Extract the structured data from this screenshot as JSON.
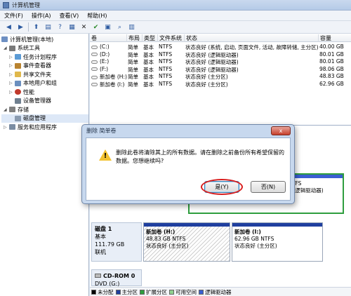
{
  "window": {
    "title": "计算机管理"
  },
  "menu": [
    "文件(F)",
    "操作(A)",
    "查看(V)",
    "帮助(H)"
  ],
  "toolbar_icons": [
    "back-icon",
    "forward-icon",
    "up-icon",
    "show-hide-tree-icon",
    "help-icon",
    "properties-icon",
    "delete-icon",
    "check-icon",
    "open-icon",
    "search-icon",
    "export-icon"
  ],
  "tree": [
    {
      "label": "计算机管理(本地)",
      "level": 0,
      "icon": "computer-icon",
      "color": "#6d8fc2"
    },
    {
      "label": "系统工具",
      "level": 1,
      "icon": "tools-icon",
      "color": "#7a7a7a"
    },
    {
      "label": "任务计划程序",
      "level": 2,
      "icon": "clock-icon",
      "color": "#5b9bd5"
    },
    {
      "label": "事件查看器",
      "level": 2,
      "icon": "event-icon",
      "color": "#b9832f"
    },
    {
      "label": "共享文件夹",
      "level": 2,
      "icon": "folder-icon",
      "color": "#e0b84b"
    },
    {
      "label": "本地用户和组",
      "level": 2,
      "icon": "users-icon",
      "color": "#6b8fbf"
    },
    {
      "label": "性能",
      "level": 2,
      "icon": "performance-icon",
      "color": "#c0392b"
    },
    {
      "label": "设备管理器",
      "level": 2,
      "icon": "device-icon",
      "color": "#6f7f8f"
    },
    {
      "label": "存储",
      "level": 1,
      "icon": "storage-icon",
      "color": "#808080"
    },
    {
      "label": "磁盘管理",
      "level": 2,
      "icon": "disk-icon",
      "color": "#8a9bb0",
      "selected": true
    },
    {
      "label": "服务和应用程序",
      "level": 1,
      "icon": "services-icon",
      "color": "#7b8da3"
    }
  ],
  "columns": [
    "卷",
    "布局",
    "类型",
    "文件系统",
    "状态",
    "容量"
  ],
  "volumes": [
    {
      "name": "(C:)",
      "layout": "简单",
      "type": "基本",
      "fs": "NTFS",
      "status": "状态良好 (系统, 启动, 页面文件, 活动, 故障转储, 主分区)",
      "capacity": "40.00 GB"
    },
    {
      "name": "(D:)",
      "layout": "简单",
      "type": "基本",
      "fs": "NTFS",
      "status": "状态良好 (逻辑驱动器)",
      "capacity": "80.01 GB"
    },
    {
      "name": "(E:)",
      "layout": "简单",
      "type": "基本",
      "fs": "NTFS",
      "status": "状态良好 (逻辑驱动器)",
      "capacity": "80.01 GB"
    },
    {
      "name": "(F:)",
      "layout": "简单",
      "type": "基本",
      "fs": "NTFS",
      "status": "状态良好 (逻辑驱动器)",
      "capacity": "98.06 GB"
    },
    {
      "name": "新加卷 (H:)",
      "layout": "简单",
      "type": "基本",
      "fs": "NTFS",
      "status": "状态良好 (主分区)",
      "capacity": "48.83 GB"
    },
    {
      "name": "新加卷 (I:)",
      "layout": "简单",
      "type": "基本",
      "fs": "NTFS",
      "status": "状态良好 (主分区)",
      "capacity": "62.96 GB"
    }
  ],
  "partial_partition": {
    "size_fs": "06 GB NTFS",
    "status": "状态良好 (逻辑驱动器)"
  },
  "disk1": {
    "name": "磁盘 1",
    "type": "基本",
    "size": "111.79 GB",
    "state": "联机",
    "partitions": [
      {
        "name": "新加卷 (H:)",
        "size_fs": "48.83 GB NTFS",
        "status": "状态良好 (主分区)"
      },
      {
        "name": "新加卷 (I:)",
        "size_fs": "62.96 GB NTFS",
        "status": "状态良好 (主分区)"
      }
    ]
  },
  "cdrom": {
    "name": "CD-ROM 0",
    "type": "DVD (G:)"
  },
  "legend": [
    {
      "label": "未分配",
      "color": "#000000"
    },
    {
      "label": "主分区",
      "color": "#1f3f9f"
    },
    {
      "label": "扩展分区",
      "color": "#2e9e3e"
    },
    {
      "label": "可用空间",
      "color": "#8fd18f"
    },
    {
      "label": "逻辑驱动器",
      "color": "#3a5fd1"
    }
  ],
  "dialog": {
    "title": "删除 简单卷",
    "message": "删除此卷将清除其上的所有数据。请在删除之前备份所有希望保留的数据。您想继续吗?",
    "yes_label": "是(Y)",
    "no_label": "否(N)",
    "close_label": "x"
  },
  "colors": {
    "primary_partition_bar": "#1f3f9f",
    "logical_bar": "#3a5fd1",
    "extended_border": "#2e9e3e",
    "highlight_oval": "#d81e1e"
  }
}
